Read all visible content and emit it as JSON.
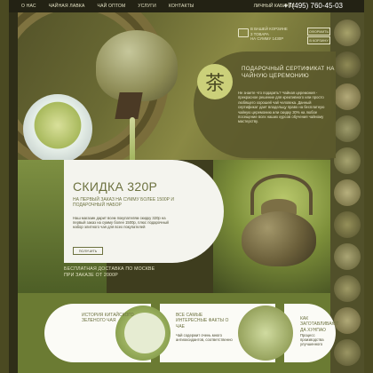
{
  "nav": {
    "items": [
      "О НАС",
      "ЧАЙНАЯ ЛАВКА",
      "ЧАЙ ОПТОМ",
      "УСЛУГИ",
      "КОНТАКТЫ"
    ],
    "cabinet": "ЛИЧНЫЙ КАБИНЕТ",
    "phone": "+7(495) 760-45-03"
  },
  "cart": {
    "lines": [
      "В ВАШЕЙ КОРЗИНЕ",
      "3 ТОВАРА",
      "НА СУММУ 1430Р"
    ],
    "checkout_label": "ОФОРМИТЬ",
    "to_cart_label": "В КОРЗИНУ"
  },
  "gift": {
    "badge_glyph": "茶",
    "title": "ПОДАРОЧНЫЙ СЕРТИФИКАТ НА ЧАЙНУЮ ЦЕРЕМОНИЮ",
    "body": "Не знаете что подарить? Чайная церемония - прекрасное решение для креативного или просто любящего хорошей чай человека. Данный сертификат дает владельцу право на бесплатную чайную церемонию или скидку 30% на любое посещение всех наших курсов обучения чайному мастерству."
  },
  "discount": {
    "title": "СКИДКА 320р",
    "subtitle": "НА ПЕРВЫЙ ЗАКАЗ НА СУММУ БОЛЕЕ 1500Р И ПОДАРОЧНЫЙ НАБОР",
    "body": "Наш магазин дарит всем покупателям скидку 320р на первый заказ на сумму более 1500р, плюс подарочный набор элитного чая для всех покупателей",
    "button_label": "ПОЛУЧИТЬ"
  },
  "delivery": {
    "line1": "БЕСПЛАТНАЯ ДОСТАВКА ПО МОСКВЕ",
    "line2": "ПРИ ЗАКАЗЕ ОТ 2000Р"
  },
  "cards": [
    {
      "title": "ИСТОРИЯ КИТАЙСКОГО ЗЕЛЕНОГО ЧАЯ",
      "body": ""
    },
    {
      "title": "ВСЕ САМЫЕ ИНТЕРЕСНЫЕ ФАКТЫ О ЧАЕ",
      "body": "Чай содержит очень много антиоксидантов, соответственно"
    },
    {
      "title": "КАК ЗАГОТАВЛИВАЮТ ДА ХУНПАО",
      "body": "Процесс производства улучшенного"
    }
  ],
  "colors": {
    "accent": "#6d7240",
    "panel": "#5c5a2c",
    "badge": "#cbd07a"
  }
}
